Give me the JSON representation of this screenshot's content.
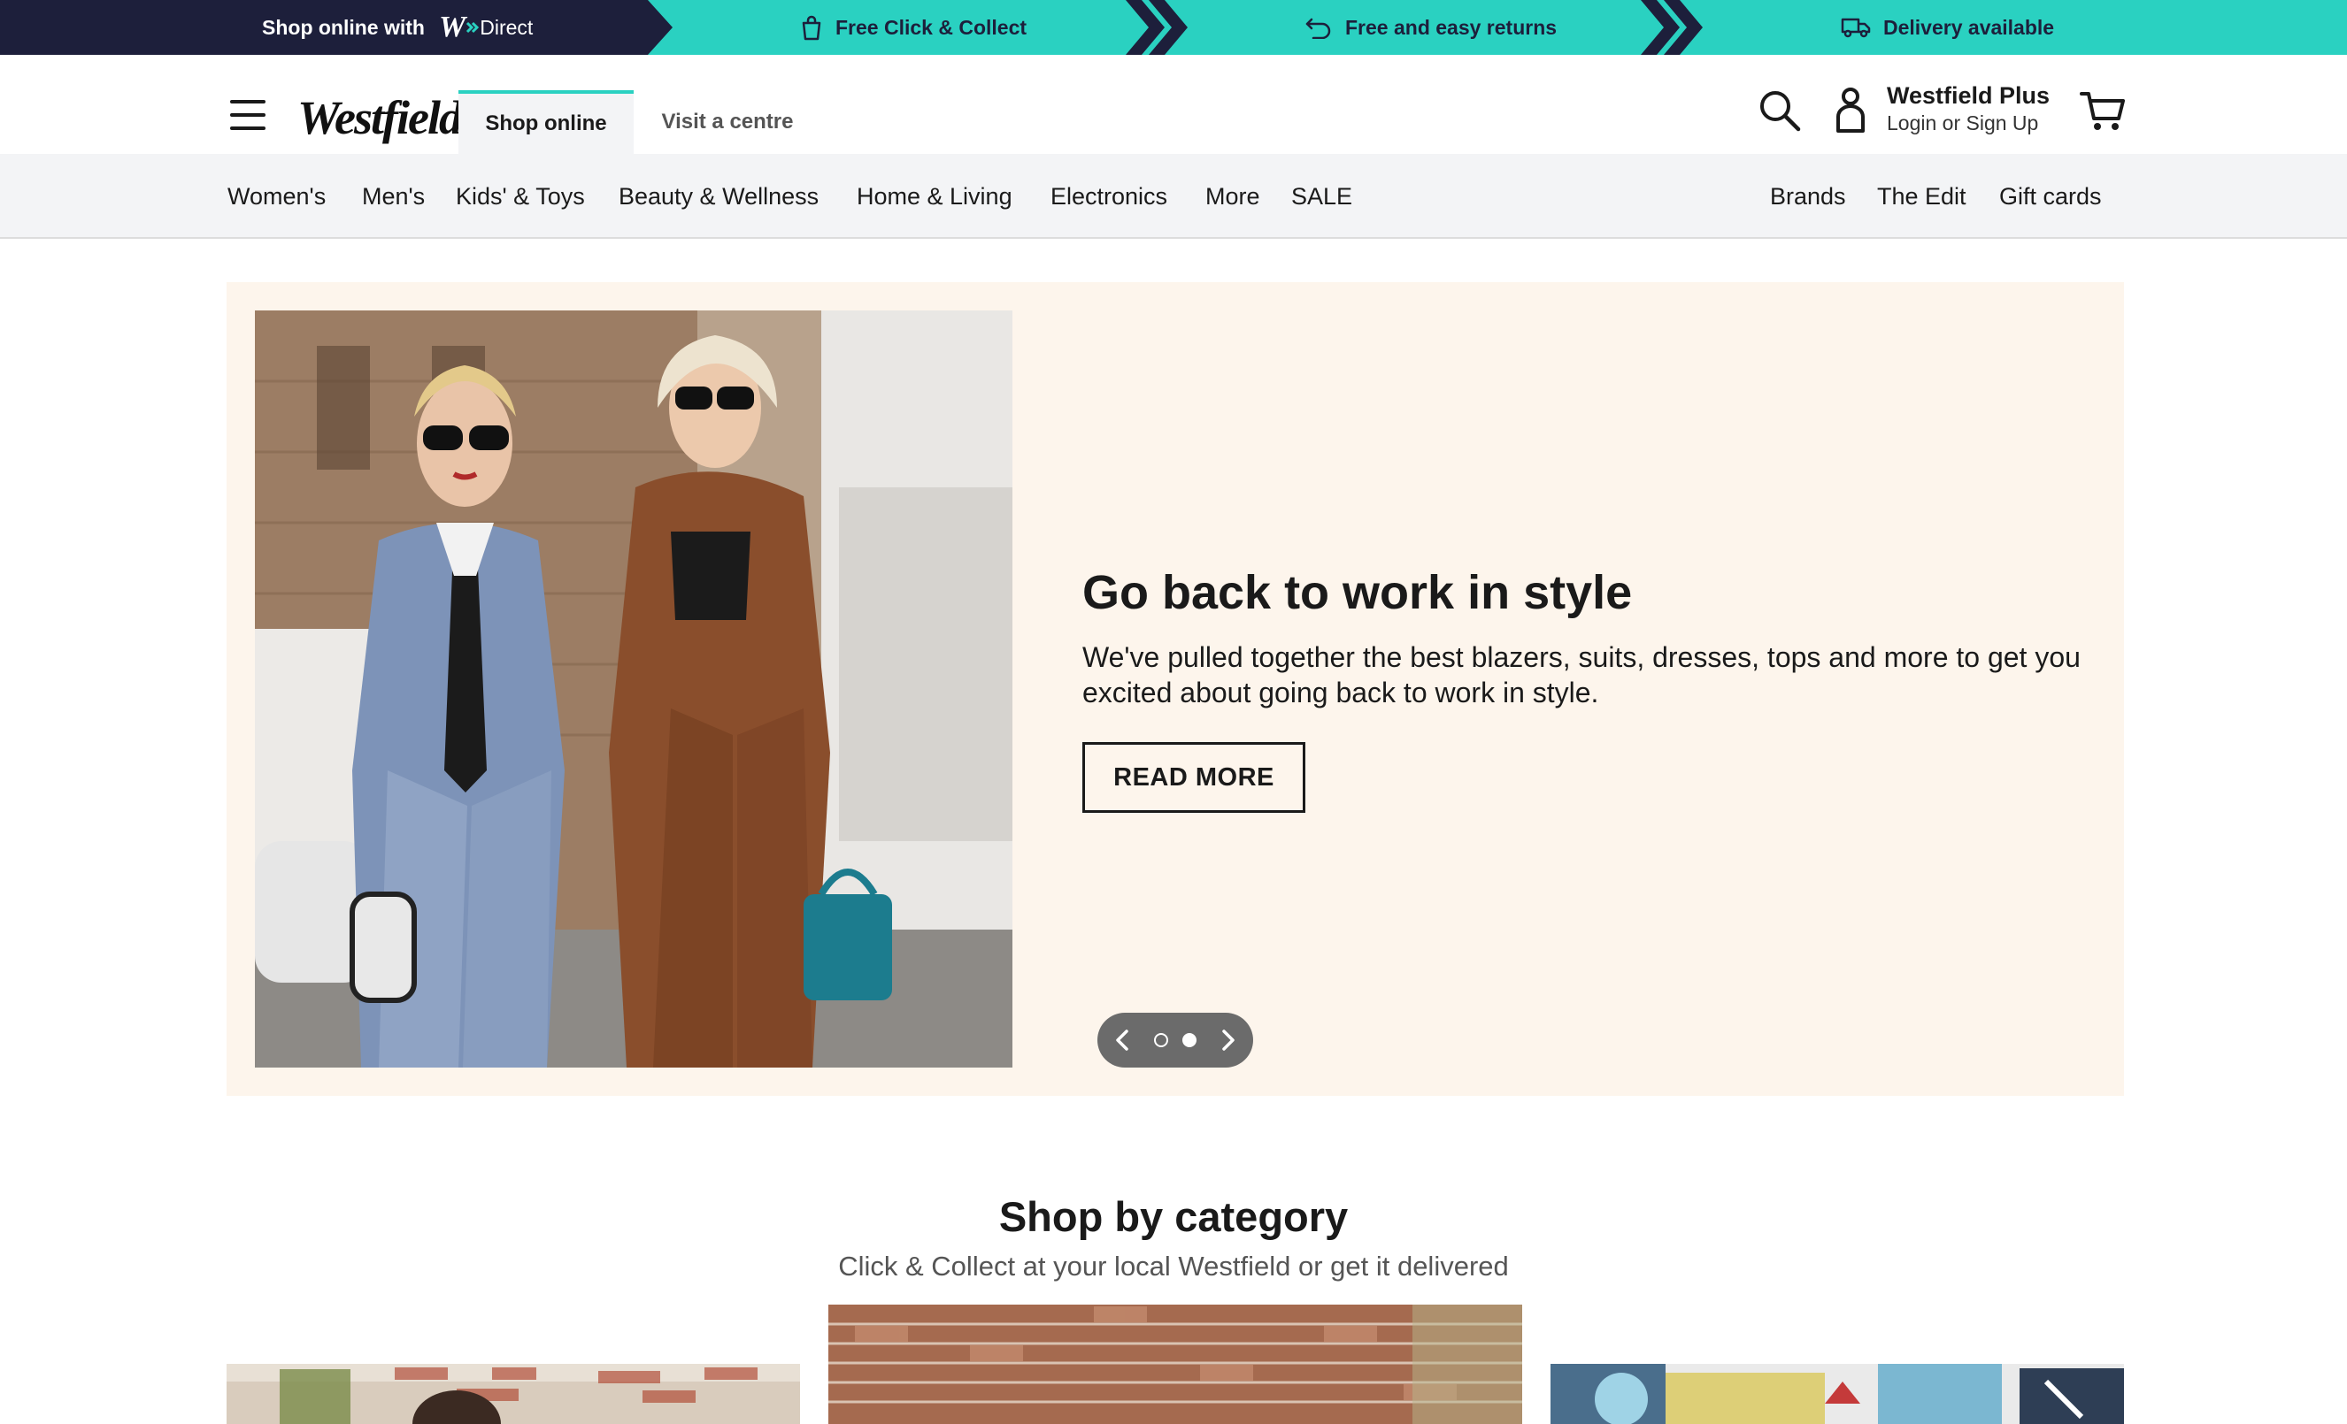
{
  "promo_bar": {
    "shop_online_prefix": "Shop online with",
    "w_logo": "W",
    "direct_label": "Direct",
    "items": [
      {
        "label": "Free Click & Collect",
        "icon": "shopping-bag-icon"
      },
      {
        "label": "Free and easy returns",
        "icon": "return-arrow-icon"
      },
      {
        "label": "Delivery available",
        "icon": "delivery-truck-icon"
      }
    ],
    "colors": {
      "dark": "#1d1f3b",
      "teal": "#2ad1c1"
    }
  },
  "header": {
    "logo": "Westfield",
    "tabs": [
      {
        "label": "Shop online",
        "active": true
      },
      {
        "label": "Visit a centre",
        "active": false
      }
    ],
    "account": {
      "title": "Westfield Plus",
      "subtitle": "Login or Sign Up"
    },
    "icons": [
      "hamburger-menu-icon",
      "search-icon",
      "user-icon",
      "cart-icon"
    ]
  },
  "category_nav": {
    "left": [
      "Women's",
      "Men's",
      "Kids' & Toys",
      "Beauty & Wellness",
      "Home & Living",
      "Electronics",
      "More",
      "SALE"
    ],
    "right": [
      "Brands",
      "The Edit",
      "Gift cards"
    ]
  },
  "hero": {
    "title": "Go back to work in style",
    "description": "We've pulled together the best blazers, suits, dresses, tops and more to get you excited about going back to work in style.",
    "cta": "READ MORE",
    "carousel": {
      "slides": 2,
      "active_index": 1
    },
    "background": "#fdf5ec"
  },
  "shop_by_category": {
    "title": "Shop by category",
    "subtitle": "Click & Collect at your local Westfield or get it delivered"
  }
}
